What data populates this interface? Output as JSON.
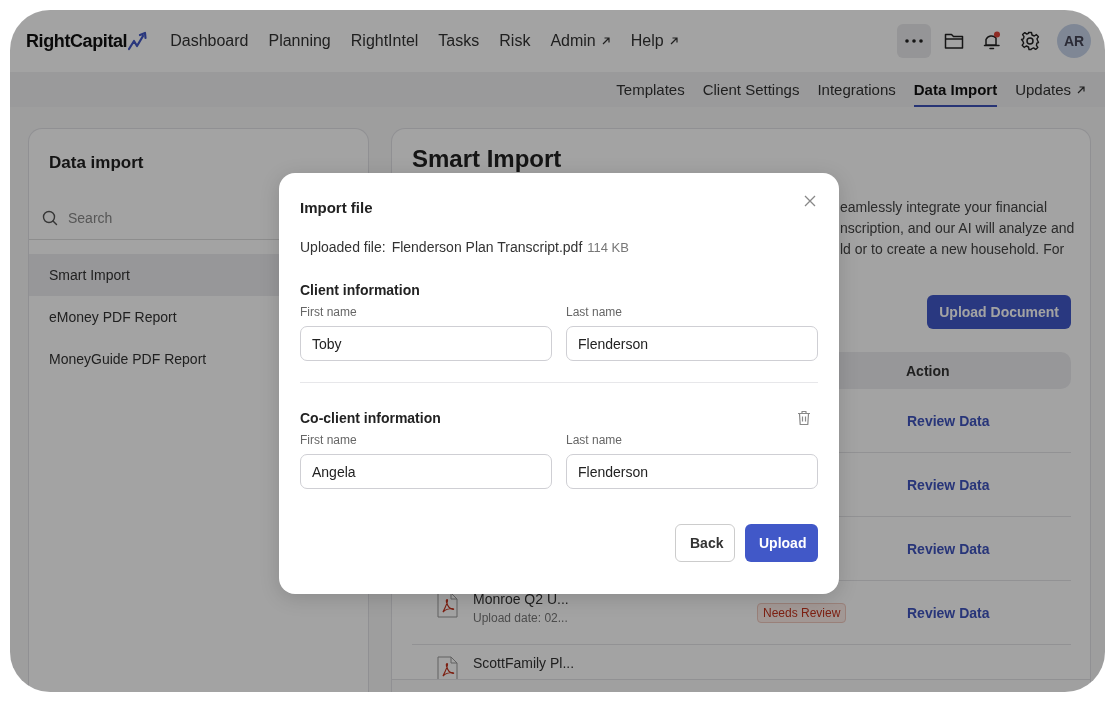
{
  "top_nav": {
    "logo": "RightCapital",
    "items": [
      {
        "label": "Dashboard",
        "external": false
      },
      {
        "label": "Planning",
        "external": false
      },
      {
        "label": "RightIntel",
        "external": false
      },
      {
        "label": "Tasks",
        "external": false
      },
      {
        "label": "Risk",
        "external": false
      },
      {
        "label": "Admin",
        "external": true
      },
      {
        "label": "Help",
        "external": true
      }
    ],
    "has_notifications": true,
    "avatar": "AR"
  },
  "sub_nav": {
    "tabs": [
      {
        "label": "Templates",
        "selected": false,
        "external": false
      },
      {
        "label": "Client Settings",
        "selected": false,
        "external": false
      },
      {
        "label": "Integrations",
        "selected": false,
        "external": false
      },
      {
        "label": "Data Import",
        "selected": true,
        "external": false
      },
      {
        "label": "Updates",
        "selected": false,
        "external": true
      }
    ]
  },
  "sidebar": {
    "title": "Data import",
    "search": {
      "placeholder": "Search"
    },
    "items": [
      {
        "label": "Smart Import",
        "selected": true
      },
      {
        "label": "eMoney PDF Report",
        "selected": false
      },
      {
        "label": "MoneyGuide PDF Report",
        "selected": false
      }
    ]
  },
  "main": {
    "title": "Smart Import",
    "description_lines": [
      "eamlessly integrate your financial",
      "nscription, and our AI will analyze and",
      "ld or to create a new household. For"
    ],
    "upload_button": "Upload Document",
    "table": {
      "columns": [
        "Action"
      ],
      "rows": [
        {
          "action": "Review Data"
        },
        {
          "action": "Review Data"
        },
        {
          "action": "Review Data"
        },
        {
          "file_name": "Monroe Q2 U...",
          "upload_date": "Upload date: 02...",
          "status": "Needs Review",
          "action": "Review Data"
        },
        {
          "file_name": "ScottFamily Pl..."
        }
      ]
    }
  },
  "dialog": {
    "title": "Import file",
    "uploaded_file_label": "Uploaded file:",
    "file_name": "Flenderson Plan Transcript.pdf",
    "file_size": "114 KB",
    "sections": [
      {
        "title": "Client information",
        "removable": false,
        "fields": [
          {
            "label": "First name",
            "value": "Toby"
          },
          {
            "label": "Last name",
            "value": "Flenderson"
          }
        ]
      },
      {
        "title": "Co-client information",
        "removable": true,
        "fields": [
          {
            "label": "First name",
            "value": "Angela"
          },
          {
            "label": "Last name",
            "value": "Flenderson"
          }
        ]
      }
    ],
    "buttons": [
      {
        "label": "Back",
        "kind": "secondary"
      },
      {
        "label": "Upload",
        "kind": "primary"
      }
    ]
  }
}
